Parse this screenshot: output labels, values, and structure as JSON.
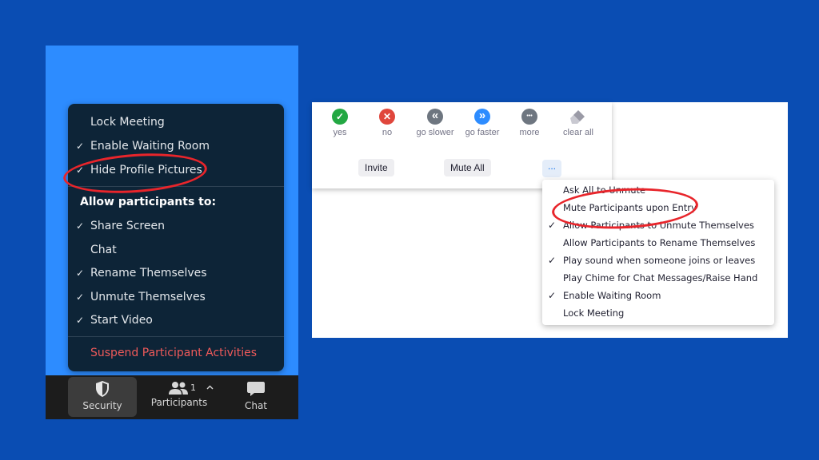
{
  "security_menu": {
    "items_top": [
      {
        "label": "Lock Meeting",
        "checked": false
      },
      {
        "label": "Enable Waiting Room",
        "checked": true
      },
      {
        "label": "Hide Profile Pictures",
        "checked": true
      }
    ],
    "section_header": "Allow participants to:",
    "items_allow": [
      {
        "label": "Share Screen",
        "checked": true
      },
      {
        "label": "Chat",
        "checked": false
      },
      {
        "label": "Rename Themselves",
        "checked": true
      },
      {
        "label": "Unmute Themselves",
        "checked": true
      },
      {
        "label": "Start Video",
        "checked": true
      }
    ],
    "danger_item": "Suspend Participant Activities",
    "check_glyph": "✓"
  },
  "toolbar": {
    "security_label": "Security",
    "participants_label": "Participants",
    "participants_count": "1",
    "chat_label": "Chat",
    "icons": [
      "shield-icon",
      "participants-icon",
      "chevron-up-icon",
      "chat-bubble-icon"
    ]
  },
  "reactions": {
    "items": [
      {
        "label": "yes",
        "glyph": "✓",
        "color": "#23a843"
      },
      {
        "label": "no",
        "glyph": "✕",
        "color": "#e0463c"
      },
      {
        "label": "go slower",
        "glyph": "«",
        "color": "#6e7680"
      },
      {
        "label": "go faster",
        "glyph": "»",
        "color": "#2d8cff"
      },
      {
        "label": "more",
        "glyph": "•••",
        "color": "#6e7680"
      },
      {
        "label": "clear all",
        "glyph": "",
        "color": "#9a9aa6"
      }
    ],
    "invite_label": "Invite",
    "mute_all_label": "Mute All",
    "more_label": "..."
  },
  "mute_menu": {
    "items": [
      {
        "label": "Ask All to Unmute",
        "checked": false
      },
      {
        "label": "Mute Participants upon Entry",
        "checked": false
      },
      {
        "label": "Allow Participants to Unmute Themselves",
        "checked": true
      },
      {
        "label": "Allow Participants to Rename Themselves",
        "checked": false
      },
      {
        "label": "Play sound when someone joins or leaves",
        "checked": true
      },
      {
        "label": "Play Chime for Chat Messages/Raise Hand",
        "checked": false
      },
      {
        "label": "Enable Waiting Room",
        "checked": true
      },
      {
        "label": "Lock Meeting",
        "checked": false
      }
    ],
    "check_glyph": "✓"
  },
  "colors": {
    "background": "#0a4db3",
    "zoom_blue": "#2d8cff",
    "menu_dark": "#0d2437",
    "danger": "#ef5a5a",
    "highlight_circle": "#e8252b"
  }
}
